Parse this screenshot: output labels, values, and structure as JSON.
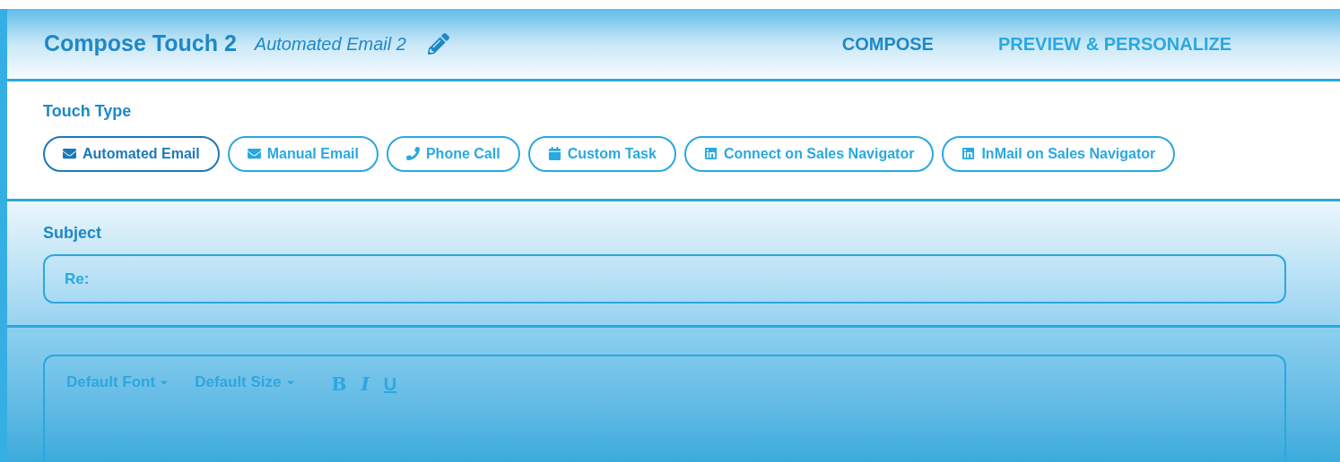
{
  "header": {
    "title": "Compose Touch 2",
    "name": "Automated Email 2"
  },
  "tabs": [
    {
      "label": "COMPOSE",
      "selected": true
    },
    {
      "label": "PREVIEW & PERSONALIZE",
      "selected": false
    }
  ],
  "touch_type": {
    "label": "Touch Type",
    "options": [
      {
        "label": "Automated Email",
        "kind": "email",
        "selected": true
      },
      {
        "label": "Manual Email",
        "kind": "email",
        "selected": false
      },
      {
        "label": "Phone Call",
        "kind": "phone",
        "selected": false
      },
      {
        "label": "Custom Task",
        "kind": "task",
        "selected": false
      },
      {
        "label": "Connect on Sales Navigator",
        "kind": "linkedin",
        "selected": false
      },
      {
        "label": "InMail on Sales Navigator",
        "kind": "linkedin",
        "selected": false
      }
    ]
  },
  "subject": {
    "label": "Subject",
    "value": "Re:"
  },
  "editor": {
    "toolbar": [
      {
        "kind": "dropdown",
        "label": "Default Font"
      },
      {
        "kind": "dropdown",
        "label": "Default Size"
      },
      {
        "kind": "bold",
        "label": "B"
      },
      {
        "kind": "italic",
        "label": "I"
      },
      {
        "kind": "underline",
        "label": "U"
      }
    ]
  }
}
